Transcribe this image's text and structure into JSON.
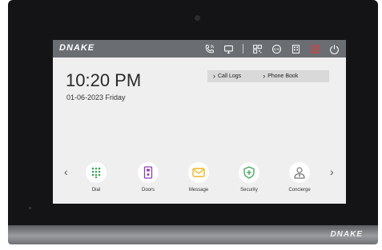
{
  "device": {
    "brand": "DNAKE"
  },
  "screen": {
    "logo": "DNAKE",
    "time": "10:20 PM",
    "date": "01-06-2023 Friday",
    "quick_links": [
      {
        "label": "Call Logs",
        "icon": "chevron-right-icon"
      },
      {
        "label": "Phone Book",
        "icon": "chevron-right-icon"
      }
    ],
    "status_icons": [
      "phone-icon",
      "monitor-icon",
      "qr-code-icon",
      "sos-icon",
      "building-icon",
      "do-not-disturb-icon",
      "power-icon"
    ],
    "apps": [
      {
        "label": "Dial",
        "icon": "keypad-icon",
        "color": "#3aa655"
      },
      {
        "label": "Doors",
        "icon": "door-icon",
        "color": "#8e3fb6"
      },
      {
        "label": "Message",
        "icon": "envelope-icon",
        "color": "#f2b623"
      },
      {
        "label": "Security",
        "icon": "shield-icon",
        "color": "#3aa655"
      },
      {
        "label": "Concierge",
        "icon": "person-icon",
        "color": "#777777"
      }
    ],
    "arrows": {
      "left": "‹",
      "right": "›"
    }
  },
  "colors": {
    "topbar": "#6a6d72",
    "screen_bg": "#efefef",
    "dnd_red": "#e23b3b"
  }
}
